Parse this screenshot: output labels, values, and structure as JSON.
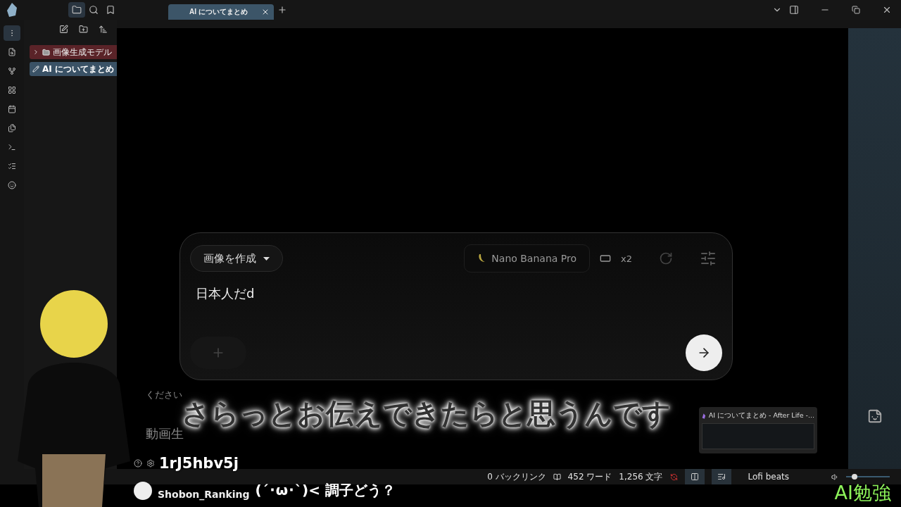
{
  "tabs": [
    {
      "label": "AI についてまとめ",
      "selected": true
    }
  ],
  "sidebar": {
    "items": [
      {
        "label": "画像生成モデル",
        "kind": "folder",
        "selected": false
      },
      {
        "label": "AI についてまとめ",
        "kind": "file",
        "selected": true
      }
    ]
  },
  "prompt": {
    "mode": "画像を作成",
    "model": "Nano Banana Pro",
    "count": "x2",
    "value": "日本人だd"
  },
  "behind_texts": [
    "ください",
    "動画生"
  ],
  "status_bar": {
    "backlinks": "0 バックリンク",
    "words": "452 ワード",
    "chars": "1,256 文字",
    "track": "Lofi beats",
    "volume": {
      "level": 0.2
    }
  },
  "overlay": {
    "subtitle": "さらっとお伝えできたらと思うんです",
    "id_text": "1rJ5hbv5j",
    "chat": {
      "user": "Shobon_Ranking",
      "message": "(´･ω･`)< 調子どう？"
    },
    "preview_title": "AI についてまとめ - After Life -...",
    "corner_label": "AI勉強"
  }
}
